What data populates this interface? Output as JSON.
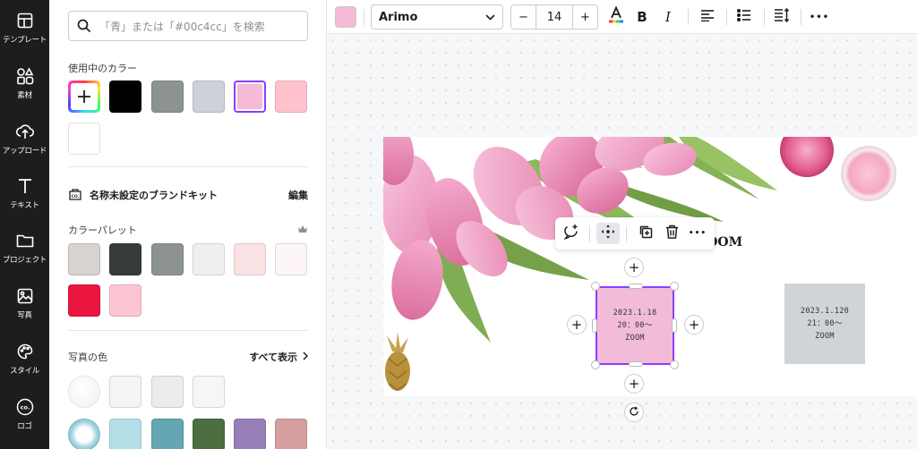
{
  "rail": {
    "items": [
      {
        "label": "テンプレート",
        "icon": "template-icon"
      },
      {
        "label": "素材",
        "icon": "elements-icon"
      },
      {
        "label": "アップロード",
        "icon": "upload-icon"
      },
      {
        "label": "テキスト",
        "icon": "text-icon"
      },
      {
        "label": "プロジェクト",
        "icon": "folder-icon"
      },
      {
        "label": "写真",
        "icon": "photo-icon"
      },
      {
        "label": "スタイル",
        "icon": "palette-icon"
      },
      {
        "label": "ロゴ",
        "icon": "logo-icon"
      }
    ]
  },
  "panel": {
    "search_placeholder": "「青」または「#00c4cc」を検索",
    "used_colors_title": "使用中のカラー",
    "used_colors": [
      "#000000",
      "#8d9293",
      "#cdd2d8",
      "#f4bad6",
      "#ffc2cd",
      "#ffffff"
    ],
    "brand_kit_title": "名称未設定のブランドキット",
    "brand_kit_edit": "編集",
    "palette_title": "カラーパレット",
    "palette_colors": [
      "#d6d3d1",
      "#373b3c",
      "#8d9293",
      "#efefef",
      "#fbe2e4",
      "#fdf5f6",
      "#ea1640",
      "#fdc4d1"
    ],
    "photo_colors_title": "写真の色",
    "show_all": "すべて表示",
    "photo_colors_row1": [
      "#f4f4f4",
      "#ececec",
      "#f6f6f6"
    ],
    "photo_colors_row2": [
      "#b4dee8",
      "#64a6b2",
      "#4d6e41",
      "#967eb6",
      "#d69e9f"
    ]
  },
  "toolbar": {
    "text_color": "#f4bad6",
    "font_name": "Arimo",
    "font_size": "14",
    "minus": "−",
    "plus": "+",
    "bold": "B",
    "italic": "I",
    "more": "•••"
  },
  "canvas": {
    "zoom_label": "ZOOM",
    "selected_box": {
      "line1": "2023.1.18",
      "line2": "20：00〜",
      "line3": "ZOOM",
      "color": "#f2bbd8"
    },
    "gray_box": {
      "line1": "2023.1.120",
      "line2": "21：00〜",
      "line3": "ZOOM",
      "color": "#d0d3d8"
    },
    "context_more": "•••"
  }
}
